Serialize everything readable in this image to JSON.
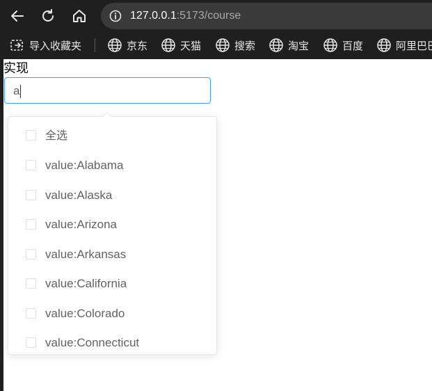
{
  "browser": {
    "url_host": "127.0.0.1",
    "url_rest": ":5173/course",
    "nav_icons": [
      "back-arrow-icon",
      "reload-icon",
      "home-icon",
      "info-icon"
    ],
    "bookmarks": [
      {
        "label": "导入收藏夹",
        "icon": "import-bookmarks-icon"
      },
      {
        "label": "京东",
        "icon": "globe-icon"
      },
      {
        "label": "天猫",
        "icon": "globe-icon"
      },
      {
        "label": "搜索",
        "icon": "globe-icon"
      },
      {
        "label": "淘宝",
        "icon": "globe-icon"
      },
      {
        "label": "百度",
        "icon": "globe-icon"
      },
      {
        "label": "阿里巴巴",
        "icon": "globe-icon"
      }
    ]
  },
  "page": {
    "heading": "实现",
    "select": {
      "input_value": "a",
      "accent_color": "#409eff",
      "options": [
        {
          "label": "全选",
          "checked": false
        },
        {
          "label": "value:Alabama",
          "checked": false
        },
        {
          "label": "value:Alaska",
          "checked": false
        },
        {
          "label": "value:Arizona",
          "checked": false
        },
        {
          "label": "value:Arkansas",
          "checked": false
        },
        {
          "label": "value:California",
          "checked": false
        },
        {
          "label": "value:Colorado",
          "checked": false
        },
        {
          "label": "value:Connecticut",
          "checked": false
        }
      ]
    }
  }
}
